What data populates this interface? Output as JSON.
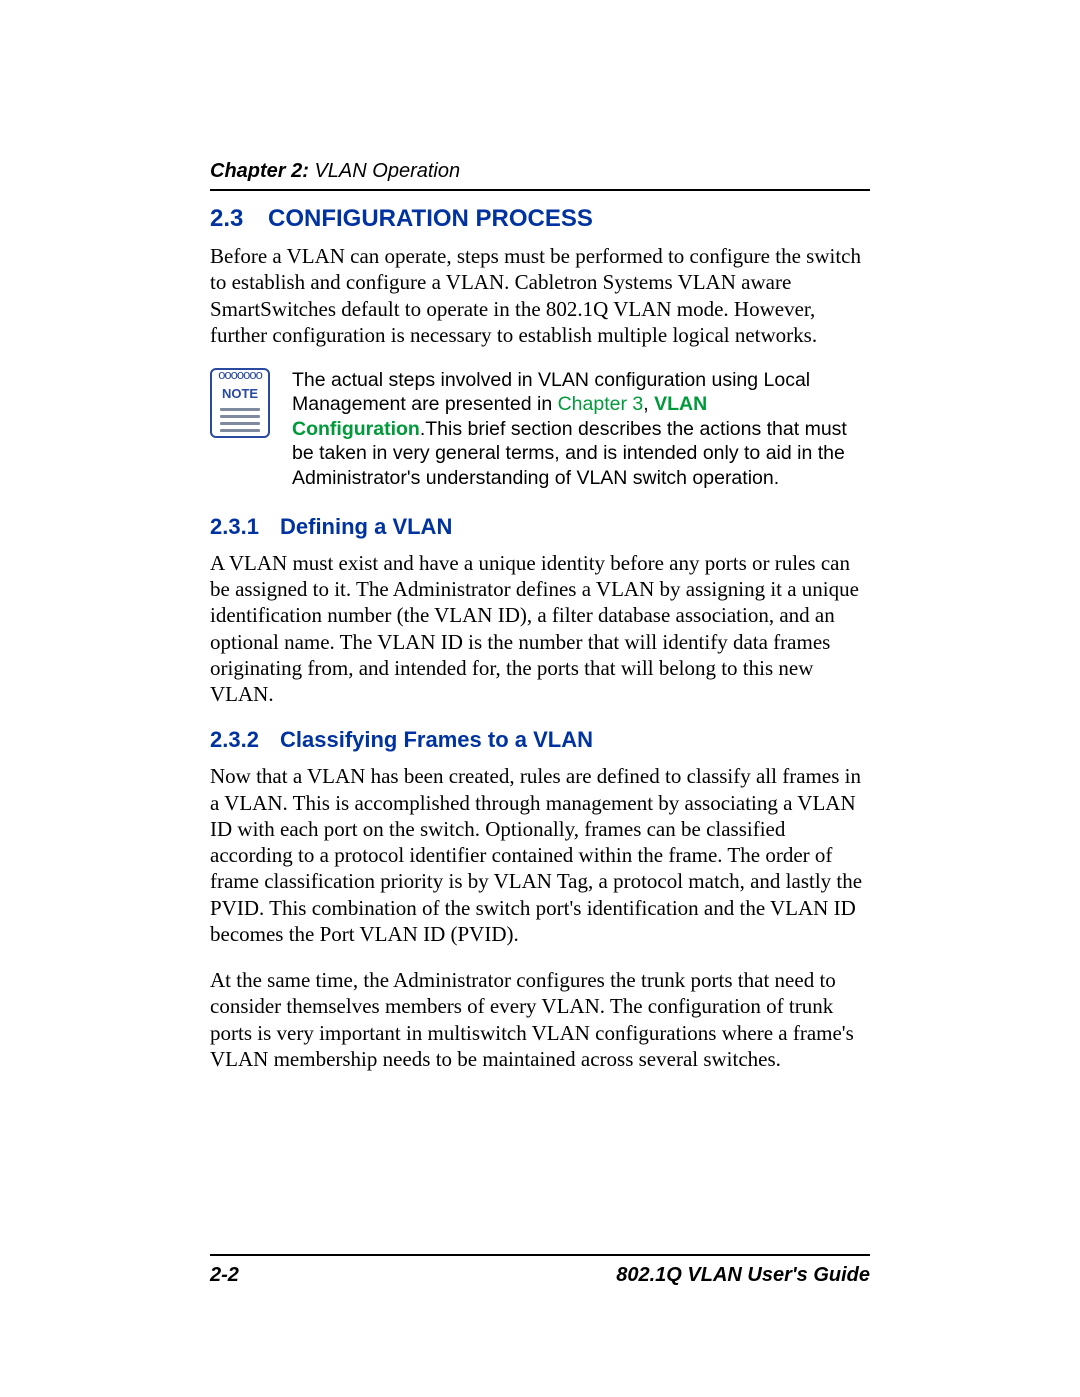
{
  "running_head": {
    "chapter": "Chapter 2:",
    "title": " VLAN Operation"
  },
  "sec23": {
    "number": "2.3",
    "title": "CONFIGURATION PROCESS",
    "body": "Before a VLAN can operate, steps must be performed to configure the switch to establish and configure a VLAN. Cabletron Systems VLAN aware SmartSwitches default to operate in the 802.1Q VLAN mode. However, further configuration is necessary to establish multiple logical networks."
  },
  "note": {
    "label": "NOTE",
    "pre": "The actual steps involved in VLAN configuration using Local Management are presented in ",
    "link1": "Chapter 3",
    "sep": ", ",
    "link2": "VLAN Configuration",
    "post": ".This brief section describes the actions that must be taken in very general terms, and is intended only to aid in the Administrator's understanding of VLAN switch operation."
  },
  "sec231": {
    "number": "2.3.1",
    "title": "Defining a VLAN",
    "body": "A VLAN must exist and have a unique identity before any ports or rules can be assigned to it. The Administrator defines a VLAN by assigning it a unique identification number (the VLAN ID), a filter database association, and an optional name. The VLAN ID is the number that will identify data frames originating from, and intended for, the ports that will belong to this new VLAN."
  },
  "sec232": {
    "number": "2.3.2",
    "title": "Classifying Frames to a VLAN",
    "body1": "Now that a VLAN has been created, rules are defined to classify all frames in a VLAN. This is accomplished through management by associating a VLAN ID with each port on the switch. Optionally, frames can be classified according to a protocol identifier contained within the frame. The order of frame classification priority is by VLAN Tag, a protocol match, and lastly the PVID. This combination of the switch port's identification and the VLAN ID becomes the Port VLAN ID (PVID).",
    "body2": "At the same time, the Administrator configures the trunk ports that need to consider themselves members of every VLAN. The configuration of trunk ports is very important in multiswitch VLAN configurations where a frame's VLAN membership needs to be maintained across several switches."
  },
  "footer": {
    "page": "2-2",
    "doc": "802.1Q VLAN User's Guide"
  }
}
